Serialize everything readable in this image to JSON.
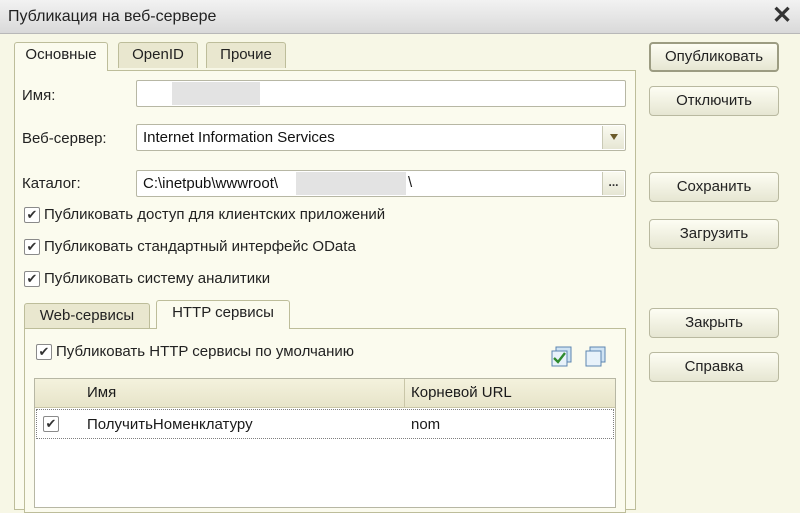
{
  "window": {
    "title": "Публикация на веб-сервере",
    "close_glyph": "✕"
  },
  "main_tabs": [
    {
      "label": "Основные",
      "active": true
    },
    {
      "label": "OpenID",
      "active": false
    },
    {
      "label": "Прочие",
      "active": false
    }
  ],
  "form": {
    "name_label": "Имя:",
    "name_value": "",
    "webserver_label": "Веб-сервер:",
    "webserver_value": "Internet Information Services",
    "catalog_label": "Каталог:",
    "catalog_prefix": "C:\\inetpub\\wwwroot\\",
    "catalog_suffix": "\\",
    "browse_glyph": "..."
  },
  "checkboxes": [
    {
      "label": "Публиковать доступ для клиентских приложений",
      "checked": true
    },
    {
      "label": "Публиковать стандартный интерфейс OData",
      "checked": true
    },
    {
      "label": "Публиковать систему аналитики",
      "checked": true
    }
  ],
  "sub_tabs": [
    {
      "label": "Web-сервисы",
      "active": false
    },
    {
      "label": "HTTP сервисы",
      "active": true
    }
  ],
  "http": {
    "publish_default_label": "Публиковать HTTP сервисы по умолчанию",
    "publish_default_checked": true,
    "columns": [
      "Имя",
      "Корневой URL"
    ],
    "rows": [
      {
        "checked": true,
        "name": "ПолучитьНоменклатуру",
        "url": "nom"
      }
    ]
  },
  "buttons": {
    "publish": "Опубликовать",
    "disable": "Отключить",
    "save": "Сохранить",
    "load": "Загрузить",
    "close": "Закрыть",
    "help": "Справка"
  },
  "check_glyph": "✔",
  "colors": {
    "window_bg": "#f7f7e6",
    "panel_bg": "#fbfbee",
    "border": "#bdbd9a"
  }
}
